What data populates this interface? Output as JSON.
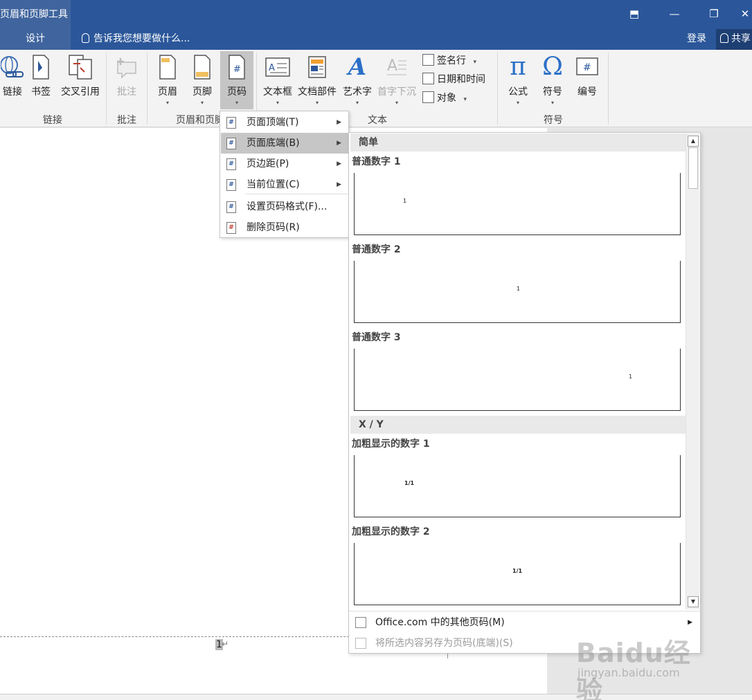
{
  "titlebar": {
    "context_tool": "页眉和页脚工具",
    "icons": [
      "ribbon-display-icon",
      "minimize-icon",
      "restore-icon",
      "close-icon"
    ],
    "glyphs": {
      "ribbon": "⬒",
      "minimize": "—",
      "restore": "❐",
      "close": "✕"
    }
  },
  "tabs": {
    "design": "设计",
    "tell_me": "告诉我您想要做什么...",
    "login": "登录",
    "share": "共享"
  },
  "ribbon": {
    "buttons": {
      "link": "链接",
      "bookmark": "书签",
      "cross_ref": "交叉引用",
      "comment": "批注",
      "header": "页眉",
      "footer": "页脚",
      "page_number": "页码",
      "textbox": "文本框",
      "doc_parts": "文档部件",
      "wordart": "艺术字",
      "dropcap": "首字下沉",
      "signature": "签名行",
      "datetime": "日期和时间",
      "object": "对象",
      "equation": "公式",
      "symbol": "符号",
      "numbering": "编号"
    },
    "groups": {
      "links": "链接",
      "comments": "批注",
      "header_footer": "页眉和页脚",
      "text": "文本",
      "symbols": "符号"
    },
    "glyphs": {
      "pi": "π",
      "omega": "Ω",
      "wordart": "A",
      "hash": "#",
      "caret": "▾"
    }
  },
  "menu": {
    "items": [
      {
        "label": "页面顶端(T)",
        "has_submenu": true
      },
      {
        "label": "页面底端(B)",
        "has_submenu": true,
        "highlighted": true
      },
      {
        "label": "页边距(P)",
        "has_submenu": true
      },
      {
        "label": "当前位置(C)",
        "has_submenu": true
      },
      {
        "label": "设置页码格式(F)...",
        "has_submenu": false
      },
      {
        "label": "删除页码(R)",
        "has_submenu": false
      }
    ],
    "arrow": "▶"
  },
  "gallery": {
    "categories": [
      {
        "name": "简单",
        "items": [
          {
            "title": "普通数字 1",
            "sample": "1",
            "align": "left"
          },
          {
            "title": "普通数字 2",
            "sample": "1",
            "align": "center"
          },
          {
            "title": "普通数字 3",
            "sample": "1",
            "align": "right"
          }
        ]
      },
      {
        "name": "X / Y",
        "items": [
          {
            "title": "加粗显示的数字 1",
            "sample": "1/1",
            "align": "left"
          },
          {
            "title": "加粗显示的数字 2",
            "sample": "1/1",
            "align": "center"
          }
        ]
      }
    ],
    "scroll": {
      "up": "▲",
      "down": "▼"
    },
    "footer": {
      "more": "Office.com 中的其他页码(M)",
      "save": "将所选内容另存为页码(底端)(S)"
    }
  },
  "document": {
    "footer_page_number": "1",
    "paragraph_mark": "↵"
  },
  "watermark": {
    "brand": "Baidu经验",
    "url": "jingyan.baidu.com"
  }
}
